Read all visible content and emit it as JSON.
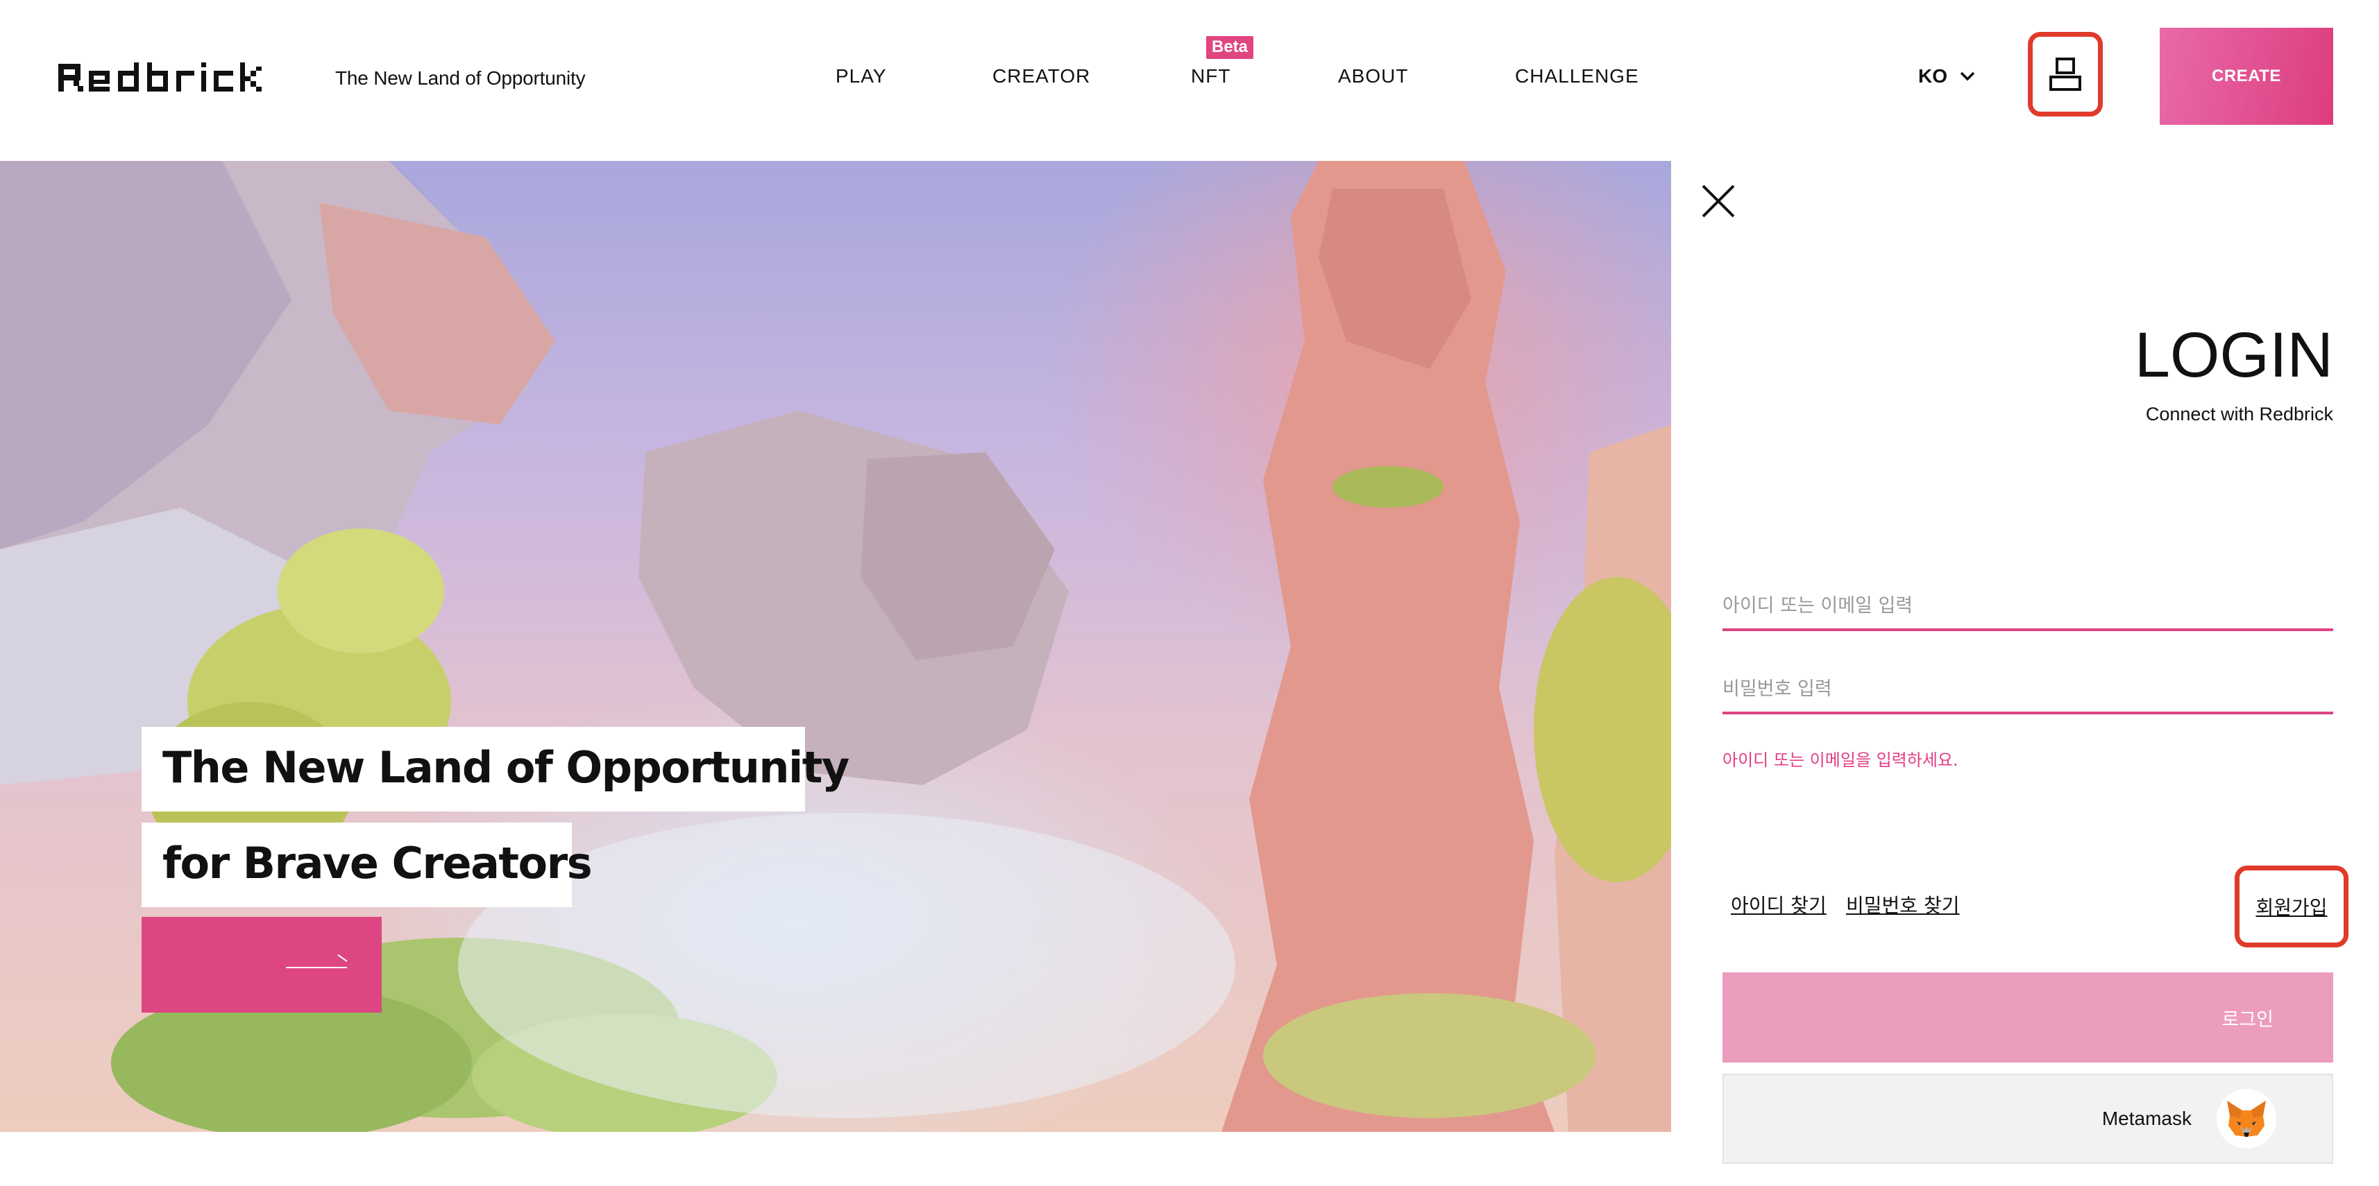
{
  "header": {
    "brand": "Redbrick",
    "tagline": "The New Land of Opportunity",
    "nav": [
      "PLAY",
      "CREATOR",
      "NFT",
      "ABOUT",
      "CHALLENGE"
    ],
    "nft_badge": "Beta",
    "language": "KO",
    "create_label": "CREATE"
  },
  "hero": {
    "title_line1": "The New Land of Opportunity",
    "title_line2": "for Brave Creators"
  },
  "login": {
    "title": "LOGIN",
    "subtitle": "Connect with Redbrick",
    "id_placeholder": "아이디 또는 이메일 입력",
    "password_placeholder": "비밀번호 입력",
    "error": "아이디 또는 이메일을 입력하세요.",
    "find_id": "아이디 찾기",
    "find_password": "비밀번호 찾기",
    "signup": "회원가입",
    "login_button": "로그인",
    "metamask_button": "Metamask"
  },
  "colors": {
    "accent": "#dd4682",
    "highlight": "#e03a2a",
    "login_button": "#ec9dbd"
  },
  "icons": {
    "user": "user-icon",
    "close": "close-icon",
    "chevron": "chevron-down-icon",
    "arrow": "arrow-right-icon",
    "metamask": "metamask-fox-icon"
  }
}
